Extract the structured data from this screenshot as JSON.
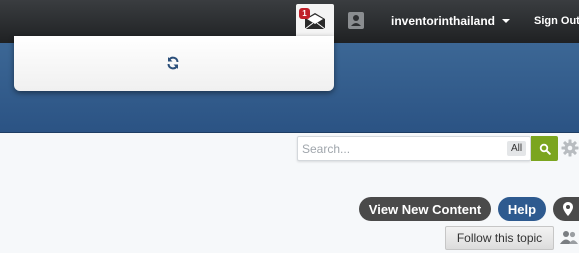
{
  "header": {
    "notification_count": "1",
    "username": "inventorinthailand",
    "sign_out_label": "Sign Out",
    "icons": [
      "envelope-icon",
      "user-badge-icon",
      "caret-down-icon"
    ]
  },
  "dropdown": {
    "loading_icon": "refresh-icon"
  },
  "search": {
    "placeholder": "Search...",
    "value": "",
    "scope_label": "All",
    "submit_icon": "search-icon",
    "options_icon": "gear-icon"
  },
  "actions": {
    "view_new_content_label": "View New Content",
    "help_label": "Help",
    "map_icon": "map-marker-icon",
    "follow_topic_label": "Follow this topic",
    "followers_icon": "people-icon"
  },
  "colors": {
    "topbar": "#2b2d2f",
    "banner": "#34608e",
    "search_button": "#7ba51f",
    "notification_badge": "#c0202a",
    "help_button": "#2e5a8f",
    "dark_pill": "#4a4a4a"
  }
}
